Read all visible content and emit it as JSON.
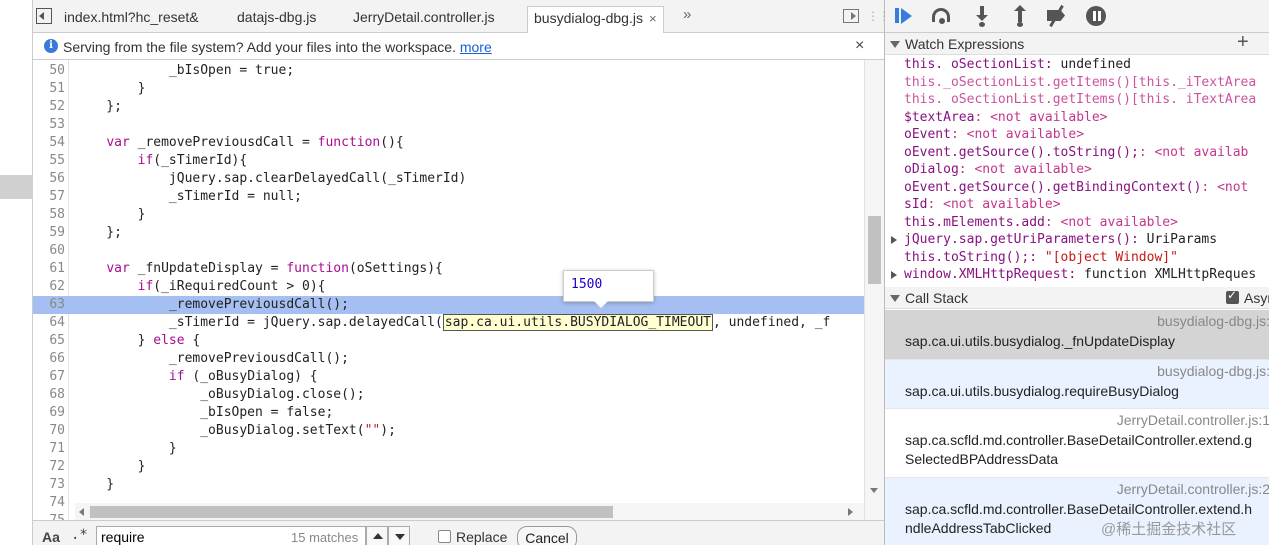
{
  "tabs": [
    {
      "label": "index.html?hc_reset&",
      "active": false
    },
    {
      "label": "datajs-dbg.js",
      "active": false
    },
    {
      "label": "JerryDetail.controller.js",
      "active": false
    },
    {
      "label": "busydialog-dbg.js",
      "active": true
    }
  ],
  "tab_more": "»",
  "infobar": {
    "message": "Serving from the file system? Add your files into the workspace.",
    "link": "more",
    "close": "×",
    "icon": "info-icon"
  },
  "code": {
    "lines": [
      {
        "n": "50",
        "t": "            _bIsOpen = true;"
      },
      {
        "n": "51",
        "t": "        }"
      },
      {
        "n": "52",
        "t": "    };"
      },
      {
        "n": "53",
        "t": ""
      },
      {
        "n": "54",
        "t": "    var _removePreviousdCall = function(){"
      },
      {
        "n": "55",
        "t": "        if(_sTimerId){"
      },
      {
        "n": "56",
        "t": "            jQuery.sap.clearDelayedCall(_sTimerId)"
      },
      {
        "n": "57",
        "t": "            _sTimerId = null;"
      },
      {
        "n": "58",
        "t": "        }"
      },
      {
        "n": "59",
        "t": "    };"
      },
      {
        "n": "60",
        "t": ""
      },
      {
        "n": "61",
        "t": "    var _fnUpdateDisplay = function(oSettings){"
      },
      {
        "n": "62",
        "t": "        if(_iRequiredCount > 0){"
      },
      {
        "n": "63",
        "t": "            _removePreviousdCall();"
      },
      {
        "n": "64a",
        "t": "            _sTimerId = jQuery.sap.delayedCall("
      },
      {
        "n": "64b",
        "t": "sap.ca.ui.utils.BUSYDIALOG_TIMEOUT"
      },
      {
        "n": "64c",
        "t": ", undefined, _f"
      },
      {
        "n": "65",
        "t": "        } else {"
      },
      {
        "n": "66",
        "t": "            _removePreviousdCall();"
      },
      {
        "n": "67",
        "t": "            if (_oBusyDialog) {"
      },
      {
        "n": "68",
        "t": "                _oBusyDialog.close();"
      },
      {
        "n": "69",
        "t": "                _bIsOpen = false;"
      },
      {
        "n": "70",
        "t": "                _oBusyDialog.setText(\"\");"
      },
      {
        "n": "71",
        "t": "            }"
      },
      {
        "n": "72",
        "t": "        }"
      },
      {
        "n": "73",
        "t": "    }"
      },
      {
        "n": "74",
        "t": ""
      },
      {
        "n": "75",
        "t": ""
      }
    ],
    "line_numbers": [
      "50",
      "51",
      "52",
      "53",
      "54",
      "55",
      "56",
      "57",
      "58",
      "59",
      "60",
      "61",
      "62",
      "63",
      "64",
      "65",
      "66",
      "67",
      "68",
      "69",
      "70",
      "71",
      "72",
      "73",
      "74",
      "75"
    ],
    "current_line": "63",
    "tooltip_value": "1500"
  },
  "search": {
    "aa": "Aa",
    "regex": ".*",
    "query": "require",
    "matches": "15 matches",
    "replace_label": "Replace",
    "cancel_label": "Cancel"
  },
  "watch": {
    "title": "Watch Expressions",
    "add": "+",
    "items": [
      {
        "expr": "this. oSectionList",
        "sep": ": ",
        "val": "undefined",
        "kind": "val",
        "exp": false
      },
      {
        "expr": "this._oSectionList.getItems()[this._iTextArea",
        "sep": "",
        "val": "",
        "kind": "dim",
        "exp": false
      },
      {
        "expr": "this. oSectionList.getItems()[this. iTextArea",
        "sep": "",
        "val": "",
        "kind": "dim",
        "exp": false
      },
      {
        "expr": "$textArea",
        "sep": ": ",
        "val": "<not available>",
        "kind": "na",
        "exp": false
      },
      {
        "expr": "oEvent",
        "sep": ": ",
        "val": "<not available>",
        "kind": "na",
        "exp": false
      },
      {
        "expr": "oEvent.getSource().toString();",
        "sep": ": ",
        "val": "<not availab",
        "kind": "na",
        "exp": false
      },
      {
        "expr": "oDialog",
        "sep": ": ",
        "val": "<not available>",
        "kind": "na",
        "exp": false
      },
      {
        "expr": "oEvent.getSource().getBindingContext()",
        "sep": ": ",
        "val": "<not",
        "kind": "na",
        "exp": false
      },
      {
        "expr": "sId",
        "sep": ": ",
        "val": "<not available>",
        "kind": "na",
        "exp": false
      },
      {
        "expr": "this.mElements.add",
        "sep": ": ",
        "val": "<not available>",
        "kind": "na",
        "exp": false
      },
      {
        "expr": "jQuery.sap.getUriParameters()",
        "sep": ": ",
        "val": "UriParams",
        "kind": "val",
        "exp": true
      },
      {
        "expr": "this.toString();",
        "sep": ": ",
        "val": "\"[object Window]\"",
        "kind": "str",
        "exp": false
      },
      {
        "expr": "window.XMLHttpRequest",
        "sep": ": ",
        "val": "function XMLHttpReques",
        "kind": "val",
        "exp": true
      }
    ]
  },
  "callstack": {
    "title": "Call Stack",
    "async_label": "Asyn",
    "frames": [
      {
        "loc": "busydialog-dbg.js:",
        "fn": "sap.ca.ui.utils.busydialog._fnUpdateDisplay"
      },
      {
        "loc": "busydialog-dbg.js:",
        "fn": "sap.ca.ui.utils.busydialog.requireBusyDialog"
      },
      {
        "loc": "JerryDetail.controller.js:1",
        "fn": "sap.ca.scfld.md.controller.BaseDetailController.extend.g\nSelectedBPAddressData"
      },
      {
        "loc": "JerryDetail.controller.js:2",
        "fn": "sap.ca.scfld.md.controller.BaseDetailController.extend.h\nndleAddressTabClicked"
      }
    ]
  },
  "watermark": "@稀土掘金技术社区"
}
